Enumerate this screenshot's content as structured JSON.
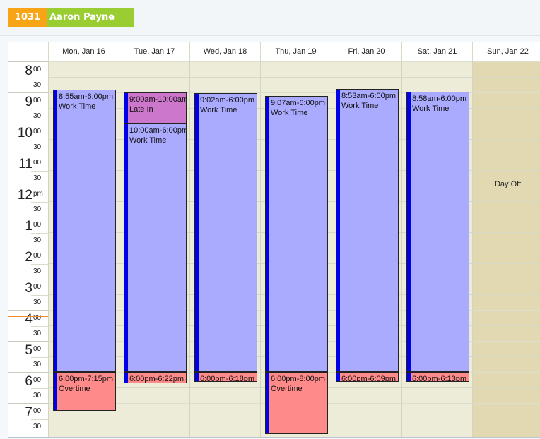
{
  "employee": {
    "id": "1031",
    "name": "Aaron Payne"
  },
  "colors": {
    "work": "#aaaaff",
    "late": "#cc77cc",
    "overtime": "#ff8a8a",
    "bar": "#0000e6",
    "dayoff": "#e2d9b2",
    "grid": "#ececd9"
  },
  "days": [
    {
      "label": "Mon, Jan 16"
    },
    {
      "label": "Tue, Jan 17"
    },
    {
      "label": "Wed, Jan 18"
    },
    {
      "label": "Thu, Jan 19"
    },
    {
      "label": "Fri, Jan 20"
    },
    {
      "label": "Sat, Jan 21"
    },
    {
      "label": "Sun, Jan 22",
      "day_off": "Day Off"
    }
  ],
  "hours": [
    {
      "num": "8",
      "suffix": "00",
      "half": "30"
    },
    {
      "num": "9",
      "suffix": "00",
      "half": "30"
    },
    {
      "num": "10",
      "suffix": "00",
      "half": "30"
    },
    {
      "num": "11",
      "suffix": "00",
      "half": "30"
    },
    {
      "num": "12",
      "suffix": "pm",
      "half": "30"
    },
    {
      "num": "1",
      "suffix": "00",
      "half": "30"
    },
    {
      "num": "2",
      "suffix": "00",
      "half": "30"
    },
    {
      "num": "3",
      "suffix": "00",
      "half": "30"
    },
    {
      "num": "4",
      "suffix": "00",
      "half": "30"
    },
    {
      "num": "5",
      "suffix": "00",
      "half": "30"
    },
    {
      "num": "6",
      "suffix": "00",
      "half": "30"
    },
    {
      "num": "7",
      "suffix": "00",
      "half": "30"
    }
  ],
  "events": [
    {
      "day": 0,
      "start": 8.917,
      "end": 18.0,
      "kind": "work",
      "time": "8:55am-6:00pm",
      "label": "Work Time"
    },
    {
      "day": 0,
      "start": 18.0,
      "end": 19.25,
      "kind": "overtime",
      "time": "6:00pm-7:15pm",
      "label": "Overtime"
    },
    {
      "day": 1,
      "start": 9.0,
      "end": 10.0,
      "kind": "late",
      "time": "9:00am-10:00am",
      "label": "Late In"
    },
    {
      "day": 1,
      "start": 10.0,
      "end": 18.0,
      "kind": "work",
      "time": "10:00am-6:00pm",
      "label": "Work Time"
    },
    {
      "day": 1,
      "start": 18.0,
      "end": 18.367,
      "kind": "overtime",
      "time": "6:00pm-6:22pm",
      "label": ""
    },
    {
      "day": 2,
      "start": 9.033,
      "end": 18.0,
      "kind": "work",
      "time": "9:02am-6:00pm",
      "label": "Work Time"
    },
    {
      "day": 2,
      "start": 18.0,
      "end": 18.3,
      "kind": "overtime",
      "time": "6:00pm-6:18pm",
      "label": ""
    },
    {
      "day": 3,
      "start": 9.117,
      "end": 18.0,
      "kind": "work",
      "time": "9:07am-6:00pm",
      "label": "Work Time"
    },
    {
      "day": 3,
      "start": 18.0,
      "end": 20.0,
      "kind": "overtime",
      "time": "6:00pm-8:00pm",
      "label": "Overtime"
    },
    {
      "day": 4,
      "start": 8.883,
      "end": 18.0,
      "kind": "work",
      "time": "8:53am-6:00pm",
      "label": "Work Time"
    },
    {
      "day": 4,
      "start": 18.0,
      "end": 18.15,
      "kind": "overtime",
      "time": "6:00pm-6:09pm",
      "label": ""
    },
    {
      "day": 5,
      "start": 8.967,
      "end": 18.0,
      "kind": "work",
      "time": "8:58am-6:00pm",
      "label": "Work Time"
    },
    {
      "day": 5,
      "start": 18.0,
      "end": 18.217,
      "kind": "overtime",
      "time": "6:00pm-6:13pm",
      "label": ""
    }
  ]
}
